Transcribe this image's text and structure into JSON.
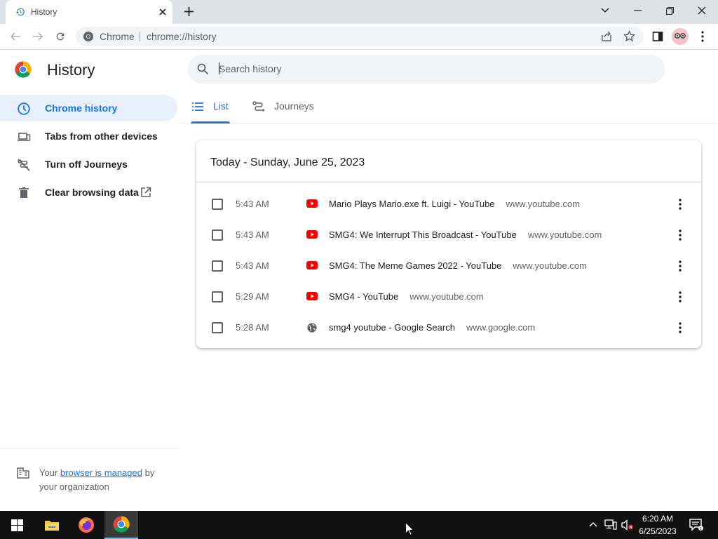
{
  "browser": {
    "tab_title": "History",
    "omnibox_site_label": "Chrome",
    "omnibox_url": "chrome://history"
  },
  "sidebar": {
    "title": "History",
    "items": [
      {
        "label": "Chrome history",
        "icon": "clock-icon",
        "active": true
      },
      {
        "label": "Tabs from other devices",
        "icon": "devices-icon",
        "active": false
      },
      {
        "label": "Turn off Journeys",
        "icon": "journeys-off-icon",
        "active": false
      },
      {
        "label": "Clear browsing data",
        "icon": "trash-icon",
        "active": false
      }
    ],
    "managed_prefix": "Your",
    "managed_link": "browser is managed",
    "managed_suffix": "by your organization"
  },
  "search": {
    "placeholder": "Search history"
  },
  "tabs": [
    {
      "label": "List",
      "active": true
    },
    {
      "label": "Journeys",
      "active": false
    }
  ],
  "history": {
    "header": "Today - Sunday, June 25, 2023",
    "entries": [
      {
        "time": "5:43 AM",
        "title": "Mario Plays Mario.exe ft. Luigi - YouTube",
        "domain": "www.youtube.com",
        "favicon": "youtube-icon"
      },
      {
        "time": "5:43 AM",
        "title": "SMG4: We Interrupt This Broadcast - YouTube",
        "domain": "www.youtube.com",
        "favicon": "youtube-icon"
      },
      {
        "time": "5:43 AM",
        "title": "SMG4: The Meme Games 2022 - YouTube",
        "domain": "www.youtube.com",
        "favicon": "youtube-icon"
      },
      {
        "time": "5:29 AM",
        "title": "SMG4 - YouTube",
        "domain": "www.youtube.com",
        "favicon": "youtube-icon"
      },
      {
        "time": "5:28 AM",
        "title": "smg4 youtube - Google Search",
        "domain": "www.google.com",
        "favicon": "globe-icon"
      }
    ]
  },
  "taskbar": {
    "time": "6:20 AM",
    "date": "6/25/2023",
    "apps": [
      "windows-start-icon",
      "file-explorer-icon",
      "firefox-icon",
      "chrome-icon"
    ]
  },
  "colors": {
    "accent": "#1a73e8",
    "youtube_red": "#ff0000",
    "active_nav_bg": "#e8f0fe"
  }
}
